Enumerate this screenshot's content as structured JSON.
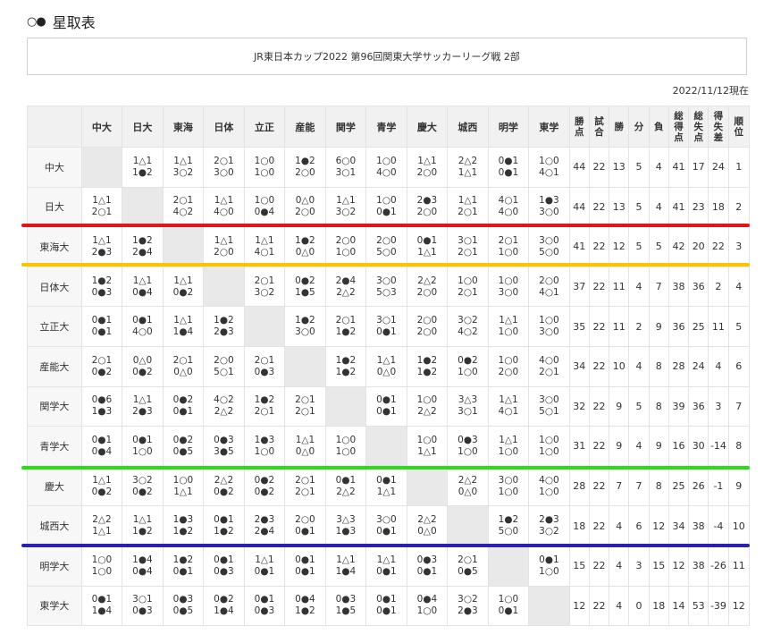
{
  "heading": {
    "marks": "○●",
    "title": "星取表"
  },
  "banner": "JR東日本カップ2022 第96回関東大学サッカーリーグ戦 2部",
  "date": "2022/11/12現在",
  "columns": [
    "中大",
    "日大",
    "東海",
    "日体",
    "立正",
    "産能",
    "関学",
    "青学",
    "慶大",
    "城西",
    "明学",
    "東学"
  ],
  "stat_headers": [
    {
      "lines": [
        "勝",
        "点"
      ]
    },
    {
      "lines": [
        "試",
        "合"
      ]
    },
    {
      "lines": [
        "勝"
      ]
    },
    {
      "lines": [
        "分"
      ]
    },
    {
      "lines": [
        "負"
      ]
    },
    {
      "lines": [
        "総",
        "得",
        "点"
      ]
    },
    {
      "lines": [
        "総",
        "失",
        "点"
      ]
    },
    {
      "lines": [
        "得",
        "失",
        "差"
      ]
    },
    {
      "lines": [
        "順",
        "位"
      ]
    }
  ],
  "rows": [
    {
      "team": "中大",
      "results": [
        null,
        [
          "1△1",
          "1●2"
        ],
        [
          "1△1",
          "3○2"
        ],
        [
          "2○1",
          "3○0"
        ],
        [
          "1○0",
          "1○0"
        ],
        [
          "1●2",
          "2○0"
        ],
        [
          "6○0",
          "3○1"
        ],
        [
          "1○0",
          "4○0"
        ],
        [
          "1△1",
          "2○0"
        ],
        [
          "2△2",
          "1△1"
        ],
        [
          "0●1",
          "0●1"
        ],
        [
          "1○0",
          "4○1"
        ]
      ],
      "stats": [
        "44",
        "22",
        "13",
        "5",
        "4",
        "41",
        "17",
        "24",
        "1"
      ]
    },
    {
      "team": "日大",
      "results": [
        [
          "1△1",
          "2○1"
        ],
        null,
        [
          "2○1",
          "4○2"
        ],
        [
          "1△1",
          "4○0"
        ],
        [
          "1○0",
          "0●4"
        ],
        [
          "0△0",
          "2○0"
        ],
        [
          "1△1",
          "3○2"
        ],
        [
          "1○0",
          "0●1"
        ],
        [
          "2●3",
          "2○0"
        ],
        [
          "1△1",
          "2○1"
        ],
        [
          "4○1",
          "4○0"
        ],
        [
          "1●3",
          "3○0"
        ]
      ],
      "stats": [
        "44",
        "22",
        "13",
        "5",
        "4",
        "41",
        "23",
        "18",
        "2"
      ]
    },
    {
      "team": "東海大",
      "results": [
        [
          "1△1",
          "2●3"
        ],
        [
          "1●2",
          "2●4"
        ],
        null,
        [
          "1△1",
          "2○0"
        ],
        [
          "1△1",
          "4○1"
        ],
        [
          "1●2",
          "0△0"
        ],
        [
          "2○0",
          "1○0"
        ],
        [
          "2○0",
          "5○0"
        ],
        [
          "0●1",
          "1△1"
        ],
        [
          "3○1",
          "2○1"
        ],
        [
          "2○1",
          "1○0"
        ],
        [
          "3○0",
          "5○0"
        ]
      ],
      "stats": [
        "41",
        "22",
        "12",
        "5",
        "5",
        "42",
        "20",
        "22",
        "3"
      ]
    },
    {
      "team": "日体大",
      "results": [
        [
          "1●2",
          "0●3"
        ],
        [
          "1△1",
          "0●4"
        ],
        [
          "1△1",
          "0●2"
        ],
        null,
        [
          "2○1",
          "3○2"
        ],
        [
          "0●2",
          "1●5"
        ],
        [
          "2●4",
          "2△2"
        ],
        [
          "3○0",
          "5○3"
        ],
        [
          "2△2",
          "2○0"
        ],
        [
          "1○0",
          "2○1"
        ],
        [
          "1○0",
          "3○0"
        ],
        [
          "2○0",
          "4○1"
        ]
      ],
      "stats": [
        "37",
        "22",
        "11",
        "4",
        "7",
        "38",
        "36",
        "2",
        "4"
      ]
    },
    {
      "team": "立正大",
      "results": [
        [
          "0●1",
          "0●1"
        ],
        [
          "0●1",
          "4○0"
        ],
        [
          "1△1",
          "1●4"
        ],
        [
          "1●2",
          "2●3"
        ],
        null,
        [
          "1●2",
          "3○0"
        ],
        [
          "2○1",
          "1●2"
        ],
        [
          "3○1",
          "0●1"
        ],
        [
          "2○0",
          "2○0"
        ],
        [
          "3○2",
          "4○2"
        ],
        [
          "1△1",
          "1○0"
        ],
        [
          "1○0",
          "3○0"
        ]
      ],
      "stats": [
        "35",
        "22",
        "11",
        "2",
        "9",
        "36",
        "25",
        "11",
        "5"
      ]
    },
    {
      "team": "産能大",
      "results": [
        [
          "2○1",
          "0●2"
        ],
        [
          "0△0",
          "0●2"
        ],
        [
          "2○1",
          "0△0"
        ],
        [
          "2○0",
          "5○1"
        ],
        [
          "2○1",
          "0●3"
        ],
        null,
        [
          "1●2",
          "1●2"
        ],
        [
          "1△1",
          "0△0"
        ],
        [
          "1●2",
          "1●2"
        ],
        [
          "0●2",
          "1○0"
        ],
        [
          "1○0",
          "2○0"
        ],
        [
          "4○0",
          "2○1"
        ]
      ],
      "stats": [
        "34",
        "22",
        "10",
        "4",
        "8",
        "28",
        "24",
        "4",
        "6"
      ]
    },
    {
      "team": "関学大",
      "results": [
        [
          "0●6",
          "1●3"
        ],
        [
          "1△1",
          "2●3"
        ],
        [
          "0●2",
          "0●1"
        ],
        [
          "4○2",
          "2△2"
        ],
        [
          "1●2",
          "2○1"
        ],
        [
          "2○1",
          "2○1"
        ],
        null,
        [
          "0●1",
          "0●1"
        ],
        [
          "1○0",
          "2△2"
        ],
        [
          "3△3",
          "3○1"
        ],
        [
          "1△1",
          "4○1"
        ],
        [
          "3○0",
          "5○1"
        ]
      ],
      "stats": [
        "32",
        "22",
        "9",
        "5",
        "8",
        "39",
        "36",
        "3",
        "7"
      ]
    },
    {
      "team": "青学大",
      "results": [
        [
          "0●1",
          "0●4"
        ],
        [
          "0●1",
          "1○0"
        ],
        [
          "0●2",
          "0●5"
        ],
        [
          "0●3",
          "3●5"
        ],
        [
          "1●3",
          "1○0"
        ],
        [
          "1△1",
          "0△0"
        ],
        [
          "1○0",
          "1○0"
        ],
        null,
        [
          "1○0",
          "1△1"
        ],
        [
          "0●3",
          "1○0"
        ],
        [
          "1△1",
          "1○0"
        ],
        [
          "1○0",
          "1○0"
        ]
      ],
      "stats": [
        "31",
        "22",
        "9",
        "4",
        "9",
        "16",
        "30",
        "-14",
        "8"
      ]
    },
    {
      "team": "慶大",
      "results": [
        [
          "1△1",
          "0●2"
        ],
        [
          "3○2",
          "0●2"
        ],
        [
          "1○0",
          "1△1"
        ],
        [
          "2△2",
          "0●2"
        ],
        [
          "0●2",
          "0●2"
        ],
        [
          "2○1",
          "2○1"
        ],
        [
          "0●1",
          "2△2"
        ],
        [
          "0●1",
          "1△1"
        ],
        null,
        [
          "2△2",
          "0△0"
        ],
        [
          "3○0",
          "1○0"
        ],
        [
          "4○0",
          "1○0"
        ]
      ],
      "stats": [
        "28",
        "22",
        "7",
        "7",
        "8",
        "25",
        "26",
        "-1",
        "9"
      ]
    },
    {
      "team": "城西大",
      "results": [
        [
          "2△2",
          "1△1"
        ],
        [
          "1△1",
          "1●2"
        ],
        [
          "1●3",
          "1●2"
        ],
        [
          "0●1",
          "1●2"
        ],
        [
          "2●3",
          "2●4"
        ],
        [
          "2○0",
          "0●1"
        ],
        [
          "3△3",
          "1●3"
        ],
        [
          "3○0",
          "0●1"
        ],
        [
          "2△2",
          "0△0"
        ],
        null,
        [
          "1●2",
          "5○0"
        ],
        [
          "2●3",
          "3○2"
        ]
      ],
      "stats": [
        "18",
        "22",
        "4",
        "6",
        "12",
        "34",
        "38",
        "-4",
        "10"
      ]
    },
    {
      "team": "明学大",
      "results": [
        [
          "1○0",
          "1○0"
        ],
        [
          "1●4",
          "0●4"
        ],
        [
          "1●2",
          "0●1"
        ],
        [
          "0●1",
          "0●3"
        ],
        [
          "1△1",
          "0●1"
        ],
        [
          "0●1",
          "0●1"
        ],
        [
          "1△1",
          "1●4"
        ],
        [
          "1△1",
          "0●1"
        ],
        [
          "0●3",
          "0●1"
        ],
        [
          "2○1",
          "0●5"
        ],
        null,
        [
          "0●1",
          "1○0"
        ]
      ],
      "stats": [
        "15",
        "22",
        "4",
        "3",
        "15",
        "12",
        "38",
        "-26",
        "11"
      ]
    },
    {
      "team": "東学大",
      "results": [
        [
          "0●1",
          "1●4"
        ],
        [
          "3○1",
          "0●3"
        ],
        [
          "0●3",
          "0●5"
        ],
        [
          "0●2",
          "1●4"
        ],
        [
          "0●1",
          "0●3"
        ],
        [
          "0●4",
          "1●2"
        ],
        [
          "0●3",
          "1●5"
        ],
        [
          "0●1",
          "0●1"
        ],
        [
          "0●4",
          "1○0"
        ],
        [
          "3○2",
          "2●3"
        ],
        [
          "1○0",
          "0●1"
        ],
        null
      ],
      "stats": [
        "12",
        "22",
        "4",
        "0",
        "18",
        "14",
        "53",
        "-39",
        "12"
      ]
    }
  ],
  "divider_colors": [
    "#e4141b",
    "#f7c600",
    "#2bdc16",
    "#2d1fb0"
  ]
}
